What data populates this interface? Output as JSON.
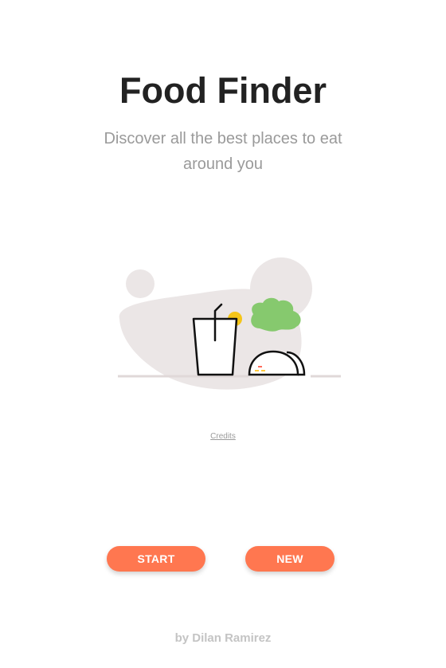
{
  "header": {
    "title": "Food Finder",
    "subtitle": "Discover all the best places to eat around you"
  },
  "illustration": {
    "icon": "food-illustration",
    "colors": {
      "blob": "#ebe6e6",
      "lettuce": "#86c96e",
      "lemon": "#f5c518",
      "stroke": "#111111",
      "accent_red": "#ff6b5a",
      "accent_yellow": "#ffc93c"
    }
  },
  "credits": {
    "label": "Credits"
  },
  "actions": {
    "start_label": "START",
    "new_label": "NEW",
    "button_color": "#ff7750"
  },
  "footer": {
    "byline": "by Dilan Ramirez"
  }
}
